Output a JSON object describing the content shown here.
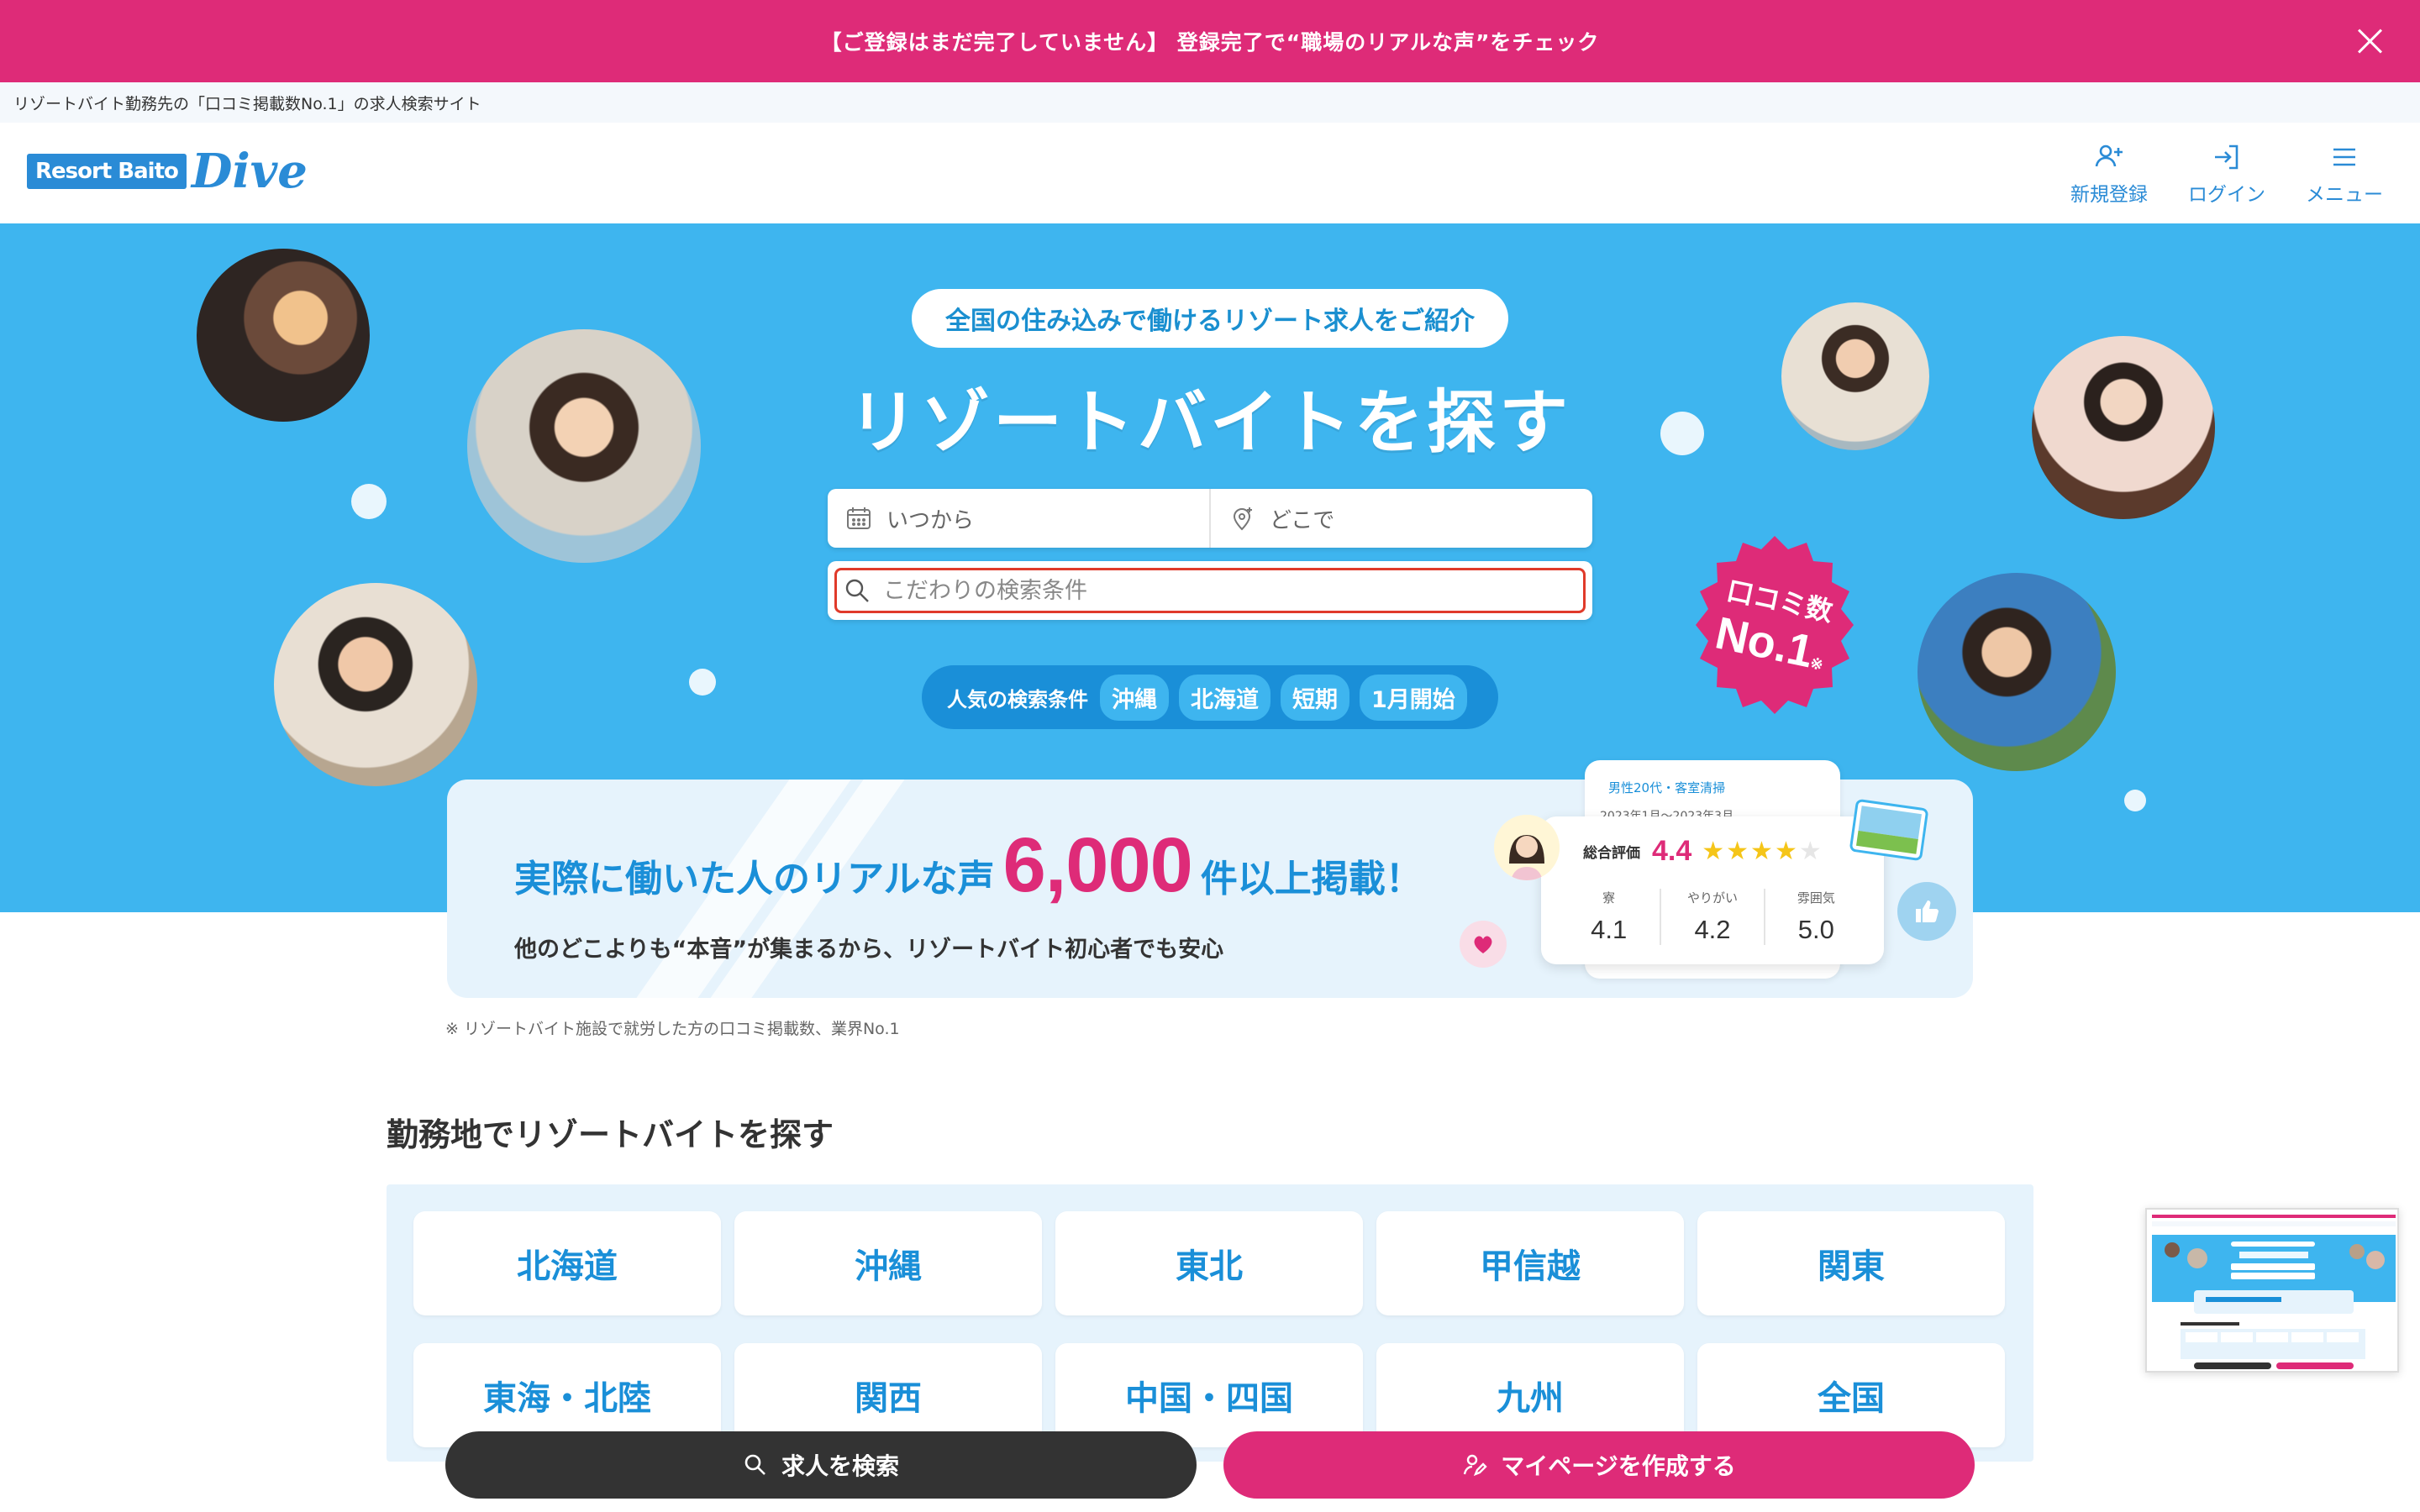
{
  "notice": {
    "text": "【ご登録はまだ完了していません】 登録完了で“職場のリアルな声”をチェック"
  },
  "tagline": "リゾートバイト勤務先の「口コミ掲載数No.1」の求人検索サイト",
  "header": {
    "logo_box": "Resort Baito",
    "logo_script": "Dive",
    "actions": [
      {
        "label": "新規登録",
        "icon": "user-plus-icon"
      },
      {
        "label": "ログイン",
        "icon": "login-icon"
      },
      {
        "label": "メニュー",
        "icon": "menu-icon"
      }
    ]
  },
  "hero": {
    "bubble": "全国の住み込みで働けるリゾート求人をご紹介",
    "title": "リゾートバイトを探す",
    "search": {
      "when_placeholder": "いつから",
      "where_placeholder": "どこで",
      "keyword_placeholder": "こだわりの検索条件"
    },
    "popular": {
      "label": "人気の検索条件",
      "chips": [
        "沖縄",
        "北海道",
        "短期",
        "1月開始"
      ]
    },
    "badge": {
      "line1": "口コミ数",
      "line2": "No.1",
      "mark": "※"
    }
  },
  "review": {
    "heading_pre": "実際に働いた人のリアルな声",
    "heading_num": "6,000",
    "heading_post": "件以上掲載！",
    "sub": "他のどこよりも“本音”が集まるから、リゾートバイト初心者でも安心",
    "card_back": {
      "tag": "男性20代・客室清掃",
      "period": "2023年1月～2023年3月"
    },
    "card": {
      "overall_label": "総合評価",
      "overall_score": "4.4",
      "stars": 4,
      "cols": [
        {
          "label": "寮",
          "value": "4.1"
        },
        {
          "label": "やりがい",
          "value": "4.2"
        },
        {
          "label": "雰囲気",
          "value": "5.0"
        }
      ]
    }
  },
  "footnote": "※ リゾートバイト施設で就労した方の口コミ掲載数、業界No.1",
  "areas": {
    "title": "勤務地でリゾートバイトを探す",
    "items": [
      "北海道",
      "沖縄",
      "東北",
      "甲信越",
      "関東",
      "東海・北陸",
      "関西",
      "中国・四国",
      "九州",
      "全国"
    ]
  },
  "cta": {
    "search": "求人を検索",
    "mypage": "マイページを作成する"
  },
  "colors": {
    "brand_blue": "#3eb5ef",
    "deep_blue": "#1a8fd8",
    "pink": "#de2b78",
    "dark": "#333333"
  }
}
